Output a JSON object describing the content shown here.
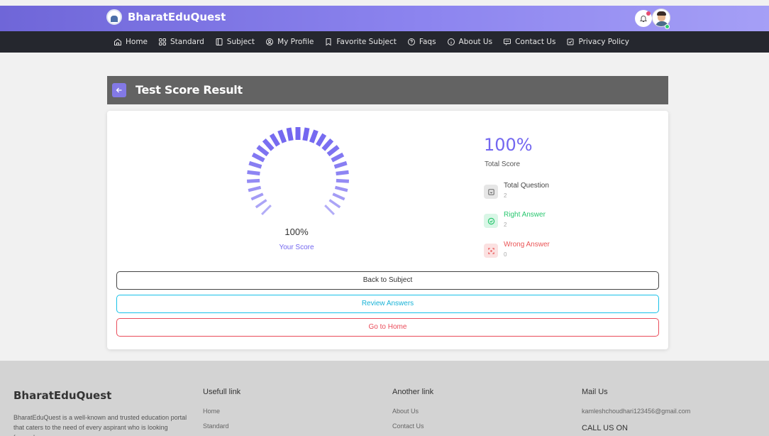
{
  "app": {
    "name": "BharatEduQuest"
  },
  "nav": {
    "items": [
      {
        "label": "Home",
        "icon": "home-icon"
      },
      {
        "label": "Standard",
        "icon": "grid-icon"
      },
      {
        "label": "Subject",
        "icon": "book-icon"
      },
      {
        "label": "My Profile",
        "icon": "user-circle-icon"
      },
      {
        "label": "Favorite Subject",
        "icon": "bookmark-icon"
      },
      {
        "label": "Faqs",
        "icon": "question-icon"
      },
      {
        "label": "About Us",
        "icon": "info-icon"
      },
      {
        "label": "Contact Us",
        "icon": "message-icon"
      },
      {
        "label": "Privacy Policy",
        "icon": "checklist-icon"
      }
    ]
  },
  "result": {
    "header_title": "Test Score Result",
    "gauge_value": "100%",
    "gauge_label": "Your Score",
    "gauge_fraction": 1.0,
    "total_score": "100%",
    "total_score_label": "Total Score",
    "stats": [
      {
        "title": "Total Question",
        "value": "2",
        "color": "#444444",
        "icon": "question-list-icon"
      },
      {
        "title": "Right Answer",
        "value": "2",
        "color": "#28c76f",
        "icon": "check-circle-icon"
      },
      {
        "title": "Wrong Answer",
        "value": "0",
        "color": "#ea5455",
        "icon": "wrong-scan-icon"
      }
    ],
    "buttons": {
      "back_to_subject": "Back to Subject",
      "review_answers": "Review Answers",
      "go_to_home": "Go to Home"
    }
  },
  "footer": {
    "brand": "BharatEduQuest",
    "description": "BharatEduQuest is a well-known and trusted education portal that caters to the need of every aspirant who is looking forward",
    "useful": {
      "title": "Usefull link",
      "links": [
        "Home",
        "Standard"
      ]
    },
    "another": {
      "title": "Another link",
      "links": [
        "About Us",
        "Contact Us"
      ]
    },
    "mail": {
      "title": "Mail Us",
      "email": "kamleshchoudhari123456@gmail.com",
      "call": "CALL US ON"
    }
  },
  "colors": {
    "accent": "#7367f0",
    "success": "#28c76f",
    "danger": "#ea5455",
    "info": "#17c1e8"
  }
}
